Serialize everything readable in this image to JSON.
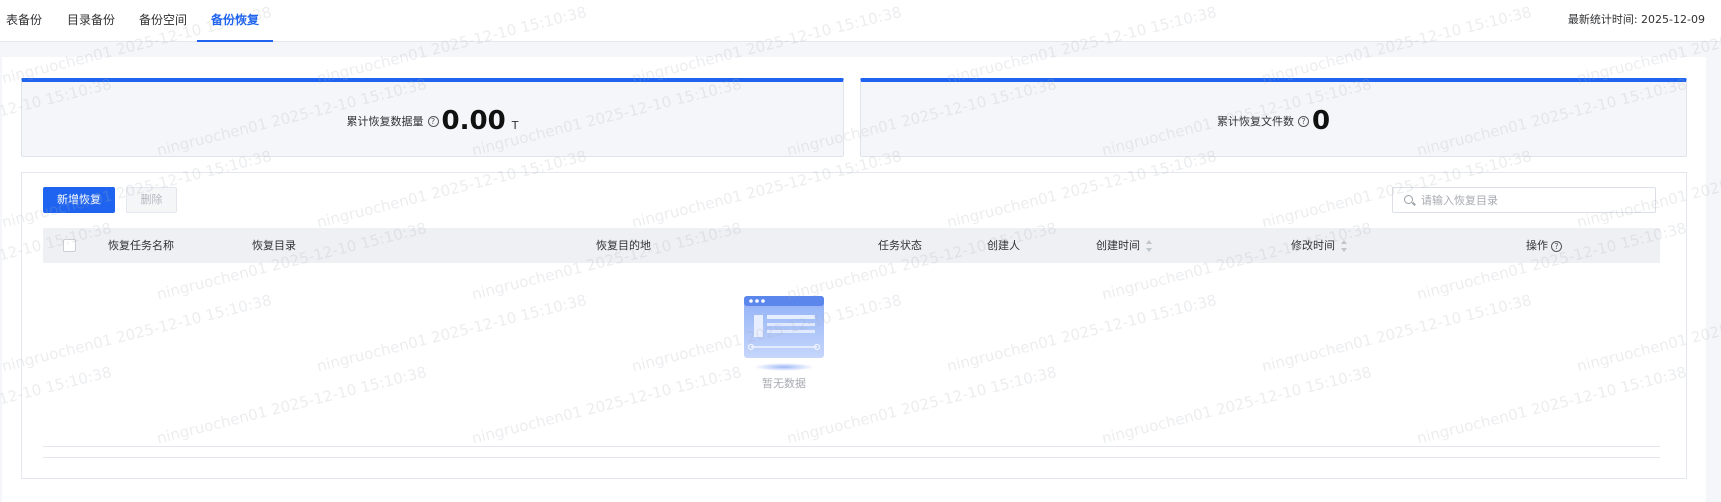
{
  "tabs": [
    {
      "label": "表备份",
      "active": false
    },
    {
      "label": "目录备份",
      "active": false
    },
    {
      "label": "备份空间",
      "active": false
    },
    {
      "label": "备份恢复",
      "active": true
    }
  ],
  "stat_time": "最新统计时间: 2025-12-09",
  "cards": [
    {
      "label": "累计恢复数据量",
      "value": "0.00",
      "unit": "T"
    },
    {
      "label": "累计恢复文件数",
      "value": "0"
    }
  ],
  "toolbar": {
    "add_label": "新增恢复",
    "delete_label": "删除",
    "search_placeholder": "请输入恢复目录"
  },
  "table": {
    "columns": [
      "恢复任务名称",
      "恢复目录",
      "恢复目的地",
      "任务状态",
      "创建人",
      "创建时间",
      "修改时间",
      "操作"
    ],
    "rows": [],
    "empty_text": "暂无数据"
  },
  "watermark_text": "ningruochen01 2025-12-10 15:10:38",
  "colors": {
    "accent": "#1e64f0",
    "header_bg": "#eef0f4",
    "page_bg": "#f4f6f9"
  }
}
